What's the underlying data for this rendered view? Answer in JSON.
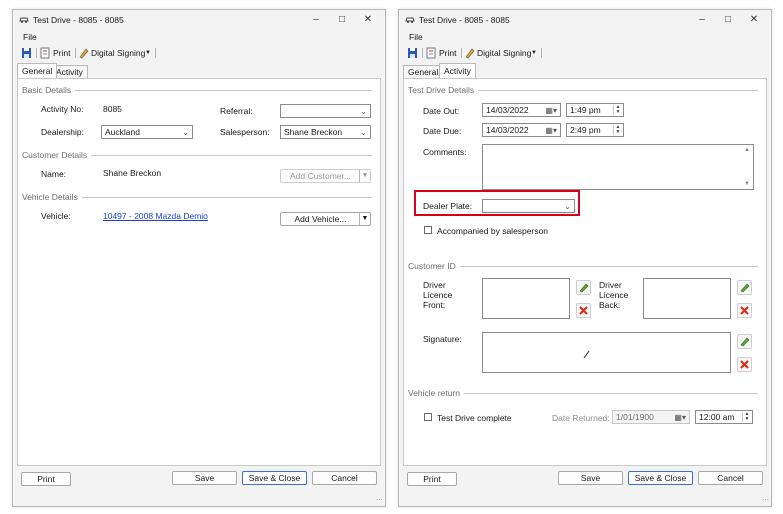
{
  "left": {
    "title": "Test Drive - 8085 - 8085",
    "menu": {
      "file": "File"
    },
    "toolbar": {
      "print": "Print",
      "digital_signing": "Digital Signing"
    },
    "tabs": [
      {
        "label": "General",
        "active": true
      },
      {
        "label": "Activity",
        "active": false
      }
    ],
    "basic": {
      "section": "Basic Details",
      "activity_no_label": "Activity No:",
      "activity_no": "8085",
      "referral_label": "Referral:",
      "referral_value": "",
      "dealership_label": "Dealership:",
      "dealership_value": "Auckland",
      "salesperson_label": "Salesperson:",
      "salesperson_value": "Shane Breckon"
    },
    "customer": {
      "section": "Customer Details",
      "name_label": "Name:",
      "name_value": "Shane Breckon",
      "add_customer": "Add Customer..."
    },
    "vehicle": {
      "section": "Vehicle Details",
      "vehicle_label": "Vehicle:",
      "vehicle_link": "10497 - 2008 Mazda Demio",
      "add_vehicle": "Add Vehicle..."
    },
    "footer": {
      "print": "Print",
      "save": "Save",
      "save_close": "Save & Close",
      "cancel": "Cancel"
    }
  },
  "right": {
    "title": "Test Drive - 8085 - 8085",
    "menu": {
      "file": "File"
    },
    "toolbar": {
      "print": "Print",
      "digital_signing": "Digital Signing"
    },
    "tabs": [
      {
        "label": "General",
        "active": false
      },
      {
        "label": "Activity",
        "active": true
      }
    ],
    "details": {
      "section": "Test Drive Details",
      "date_out_label": "Date Out:",
      "date_out": "14/03/2022",
      "time_out": "1:49 pm",
      "date_due_label": "Date Due:",
      "date_due": "14/03/2022",
      "time_due": "2:49 pm",
      "comments_label": "Comments:",
      "dealer_plate_label": "Dealer Plate:",
      "dealer_plate_value": "",
      "accompanied_label": "Accompanied by salesperson"
    },
    "customer_id": {
      "section": "Customer ID",
      "front_label": "Driver\nLicence\nFront:",
      "back_label": "Driver\nLicence\nBack:",
      "signature_label": "Signature:"
    },
    "vehicle_return": {
      "section": "Vehicle return",
      "complete_label": "Test Drive complete",
      "date_returned_label": "Date Returned:",
      "date_returned": "1/01/1900",
      "time_returned": "12:00 am"
    },
    "footer": {
      "print": "Print",
      "save": "Save",
      "save_close": "Save & Close",
      "cancel": "Cancel"
    }
  },
  "colors": {
    "highlight": "#d8001a",
    "link": "#1a3fc7",
    "primary_border": "#3a6fd0"
  }
}
